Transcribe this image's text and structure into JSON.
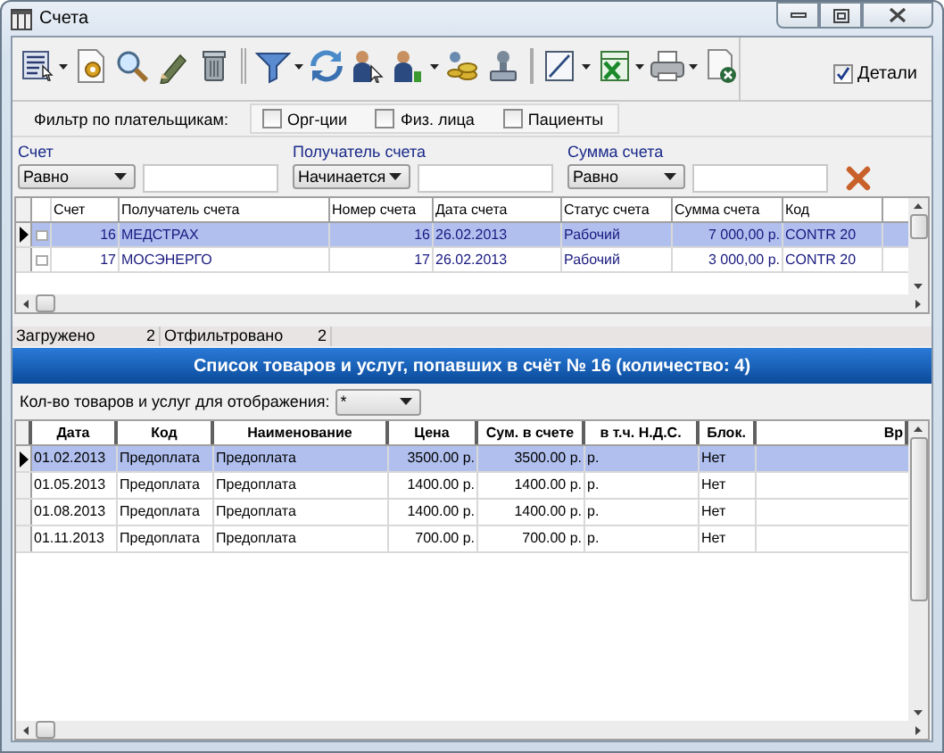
{
  "window": {
    "title": "Счета"
  },
  "toolbar": {
    "groups": [
      [
        {
          "kind": "list",
          "dropdown": true
        },
        {
          "kind": "gear-page",
          "dropdown": false
        },
        {
          "kind": "search",
          "dropdown": false
        },
        {
          "kind": "pencil",
          "dropdown": false
        },
        {
          "kind": "trash",
          "dropdown": false
        }
      ],
      [
        {
          "kind": "filter",
          "dropdown": true
        },
        {
          "kind": "refresh",
          "dropdown": false
        },
        {
          "kind": "person-cursor",
          "dropdown": false
        },
        {
          "kind": "person",
          "dropdown": true
        },
        {
          "kind": "coins",
          "dropdown": false
        },
        {
          "kind": "stamp",
          "dropdown": false
        }
      ],
      [
        {
          "kind": "resize",
          "dropdown": true
        },
        {
          "kind": "spreadsheet",
          "dropdown": true
        },
        {
          "kind": "printer",
          "dropdown": true
        },
        {
          "kind": "close-doc",
          "dropdown": false
        }
      ]
    ],
    "details": {
      "label": "Детали",
      "checked": true
    }
  },
  "payer_filter": {
    "label": "Фильтр по плательщикам:",
    "options": [
      {
        "label": "Орг-ции",
        "checked": false
      },
      {
        "label": "Физ. лица",
        "checked": false
      },
      {
        "label": "Пациенты",
        "checked": false
      }
    ]
  },
  "filters": [
    {
      "label": "Счет",
      "operator": "Равно"
    },
    {
      "label": "Получатель счета",
      "operator": "Начинается"
    },
    {
      "label": "Сумма счета",
      "operator": "Равно"
    }
  ],
  "invoices": {
    "columns": [
      {
        "title": "Счет",
        "kind": "number"
      },
      {
        "title": "Получатель счета",
        "kind": "text"
      },
      {
        "title": "Номер счета",
        "kind": "number"
      },
      {
        "title": "Дата счета",
        "kind": "text"
      },
      {
        "title": "Статус счета",
        "kind": "text"
      },
      {
        "title": "Сумма счета",
        "kind": "number"
      },
      {
        "title": "Код",
        "kind": "text"
      }
    ],
    "rows": [
      {
        "selected": true,
        "checked": false,
        "cells": [
          "16",
          "МЕДСТРАХ",
          "16",
          "26.02.2013",
          "Рабочий",
          "7 000,00 р.",
          "CONTR 20"
        ]
      },
      {
        "selected": false,
        "checked": false,
        "cells": [
          "17",
          "МОСЭНЕРГО",
          "17",
          "26.02.2013",
          "Рабочий",
          "3 000,00 р.",
          "CONTR 20"
        ]
      }
    ]
  },
  "status": [
    {
      "label": "Загружено",
      "value": "2"
    },
    {
      "label": "Отфильтровано",
      "value": "2"
    }
  ],
  "details_panel": {
    "title": "Список товаров и услуг, попавших в счёт № 16 (количество: 4)",
    "count_label": "Кол-во товаров и услуг для отображения:",
    "count_value": "*"
  },
  "items": {
    "columns": [
      {
        "title": "Дата",
        "kind": "text"
      },
      {
        "title": "Код",
        "kind": "text"
      },
      {
        "title": "Наименование",
        "kind": "text"
      },
      {
        "title": "Цена",
        "kind": "number"
      },
      {
        "title": "Сум. в счете",
        "kind": "number"
      },
      {
        "title": "в т.ч. Н.Д.С.",
        "kind": "text"
      },
      {
        "title": "Блок.",
        "kind": "text"
      },
      {
        "title": "Вр",
        "kind": "clipped"
      }
    ],
    "rows": [
      {
        "selected": true,
        "cells": [
          "01.02.2013",
          "Предоплата",
          "Предоплата",
          "3500.00 р.",
          "3500.00 р.",
          "р.",
          "Нет"
        ]
      },
      {
        "selected": false,
        "cells": [
          "01.05.2013",
          "Предоплата",
          "Предоплата",
          "1400.00 р.",
          "1400.00 р.",
          "р.",
          "Нет"
        ]
      },
      {
        "selected": false,
        "cells": [
          "01.08.2013",
          "Предоплата",
          "Предоплата",
          "1400.00 р.",
          "1400.00 р.",
          "р.",
          "Нет"
        ]
      },
      {
        "selected": false,
        "cells": [
          "01.11.2013",
          "Предоплата",
          "Предоплата",
          "700.00 р.",
          "700.00 р.",
          "р.",
          "Нет"
        ]
      }
    ]
  }
}
